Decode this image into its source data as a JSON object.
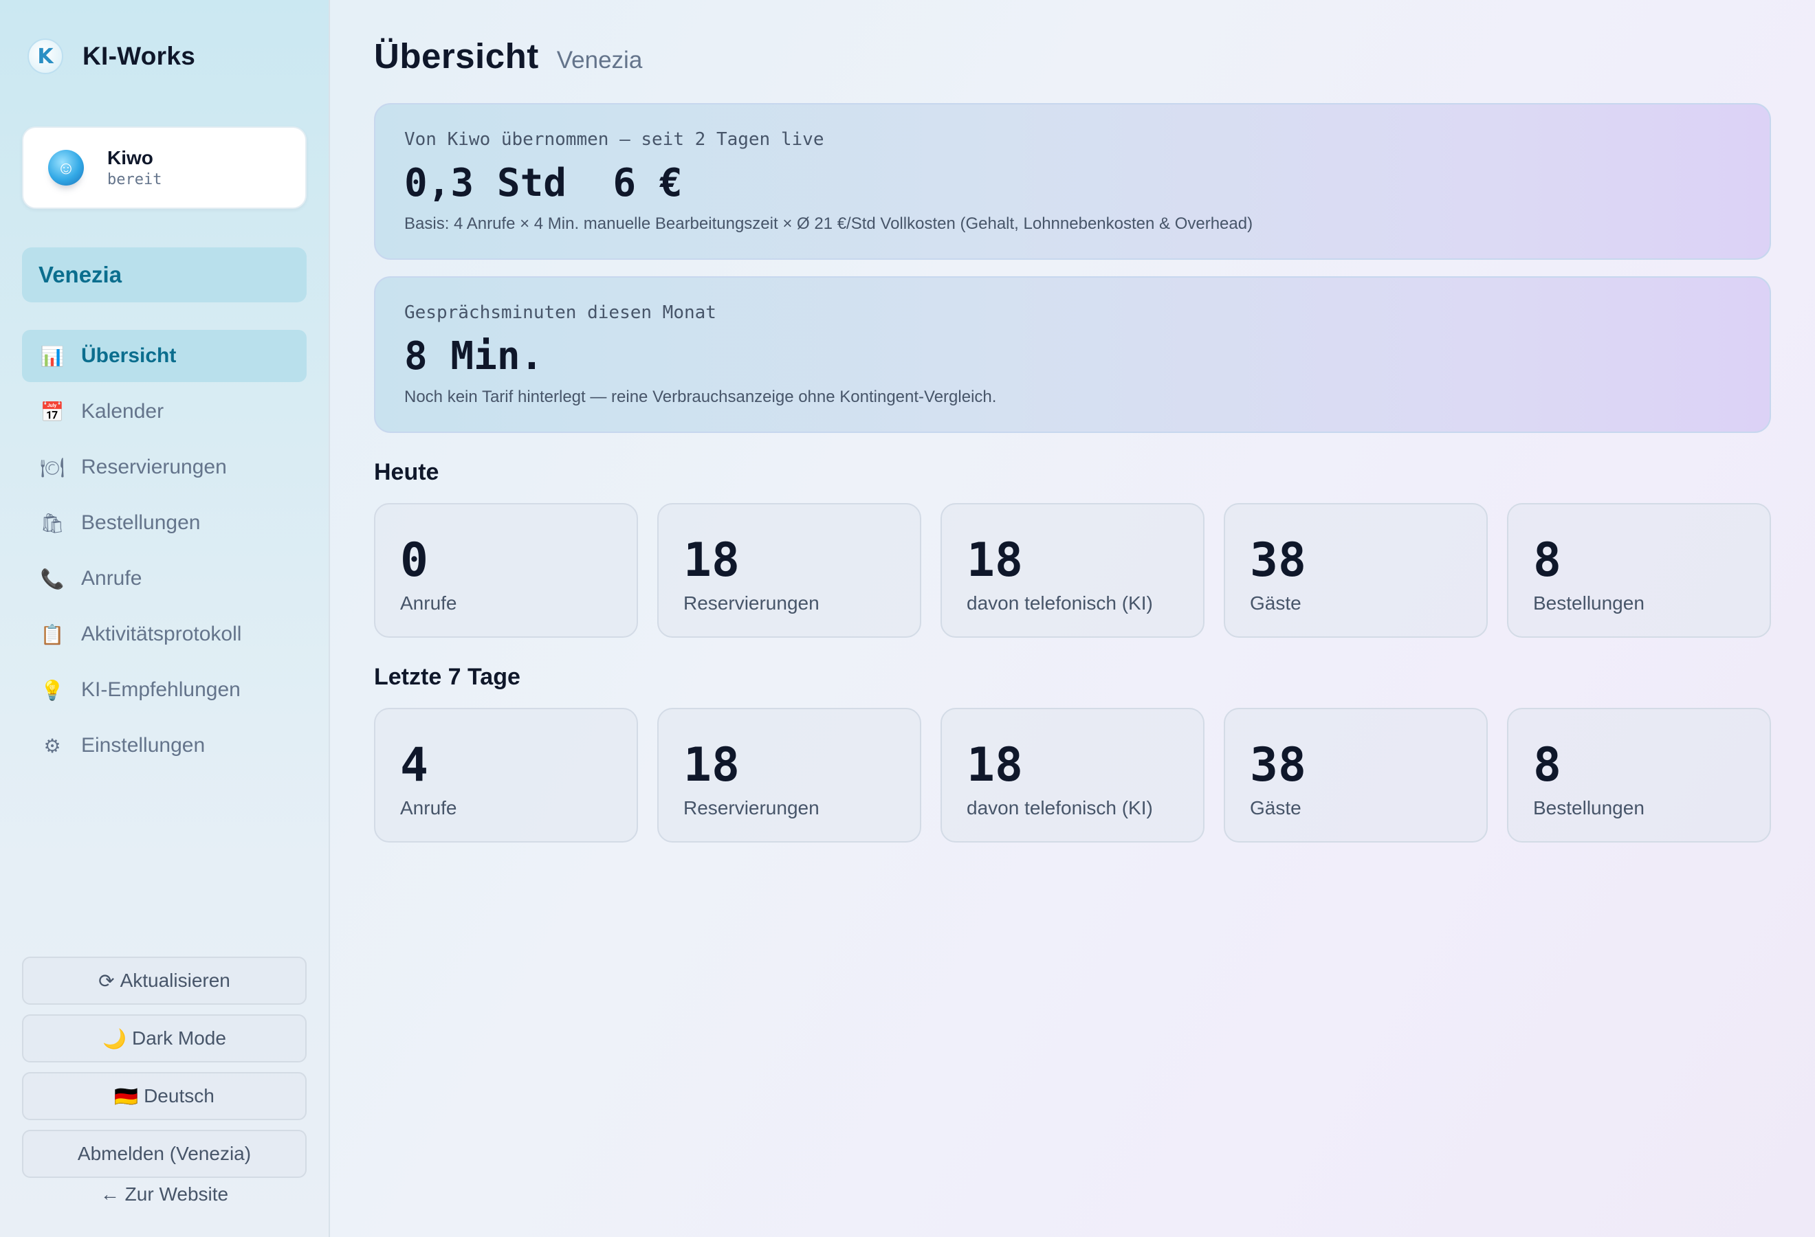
{
  "brand": {
    "logo_letter": "K",
    "name": "KI-Works"
  },
  "agent": {
    "name": "Kiwo",
    "status": "bereit",
    "avatar_glyph": "☺"
  },
  "tenant": "Venezia",
  "nav": [
    {
      "icon": "📊",
      "icon_name": "bar-chart-icon",
      "label": "Übersicht",
      "active": true
    },
    {
      "icon": "📅",
      "icon_name": "calendar-icon",
      "label": "Kalender",
      "active": false
    },
    {
      "icon": "🍽",
      "icon_name": "plate-icon",
      "label": "Reservierungen",
      "active": false
    },
    {
      "icon": "🛍",
      "icon_name": "shopping-bags-icon",
      "label": "Bestellungen",
      "active": false
    },
    {
      "icon": "📞",
      "icon_name": "phone-icon",
      "label": "Anrufe",
      "active": false
    },
    {
      "icon": "📋",
      "icon_name": "clipboard-icon",
      "label": "Aktivitätsprotokoll",
      "active": false
    },
    {
      "icon": "💡",
      "icon_name": "lightbulb-icon",
      "label": "KI-Empfehlungen",
      "active": false
    },
    {
      "icon": "⚙",
      "icon_name": "gear-icon",
      "label": "Einstellungen",
      "active": false
    }
  ],
  "sidebar_buttons": {
    "refresh": {
      "icon": "⟳",
      "label": "Aktualisieren"
    },
    "dark_mode": {
      "icon": "🌙",
      "label": "Dark Mode"
    },
    "language": {
      "icon": "🇩🇪",
      "label": "Deutsch"
    },
    "logout": {
      "label": "Abmelden (Venezia)"
    },
    "back": {
      "label": "← Zur Website"
    }
  },
  "page": {
    "title": "Übersicht",
    "subtitle": "Venezia"
  },
  "savings": {
    "label": "Von Kiwo übernommen — seit 2 Tagen live",
    "value": "0,3 Std  6 €",
    "note": "Basis: 4 Anrufe × 4 Min. manuelle Bearbeitungszeit × Ø 21 €/Std Vollkosten (Gehalt, Lohnnebenkosten & Overhead)"
  },
  "minutes": {
    "label": "Gesprächsminuten diesen Monat",
    "value": "8 Min.",
    "note": "Noch kein Tarif hinterlegt — reine Verbrauchsanzeige ohne Kontingent-Vergleich."
  },
  "today": {
    "title": "Heute",
    "stats": [
      {
        "value": "0",
        "label": "Anrufe"
      },
      {
        "value": "18",
        "label": "Reservierungen"
      },
      {
        "value": "18",
        "label": "davon telefonisch (KI)"
      },
      {
        "value": "38",
        "label": "Gäste"
      },
      {
        "value": "8",
        "label": "Bestellungen"
      }
    ]
  },
  "week": {
    "title": "Letzte 7 Tage",
    "stats": [
      {
        "value": "4",
        "label": "Anrufe"
      },
      {
        "value": "18",
        "label": "Reservierungen"
      },
      {
        "value": "18",
        "label": "davon telefonisch (KI)"
      },
      {
        "value": "38",
        "label": "Gäste"
      },
      {
        "value": "8",
        "label": "Bestellungen"
      }
    ]
  }
}
